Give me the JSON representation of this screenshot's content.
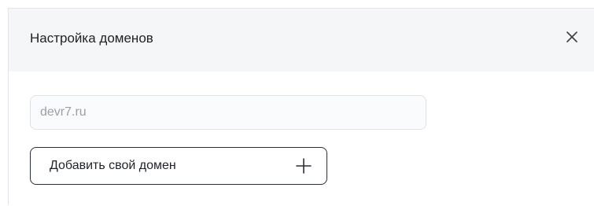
{
  "dialog": {
    "title": "Настройка доменов",
    "close_icon": "close-icon"
  },
  "domain_input": {
    "value": "devr7.ru",
    "placeholder": ""
  },
  "add_domain_button": {
    "label": "Добавить свой домен",
    "icon": "plus-icon"
  },
  "colors": {
    "header_bg": "#f4f6f8",
    "field_border": "#dfe2e6",
    "button_border": "#2a2f36",
    "muted_text": "#9aa0a6"
  }
}
